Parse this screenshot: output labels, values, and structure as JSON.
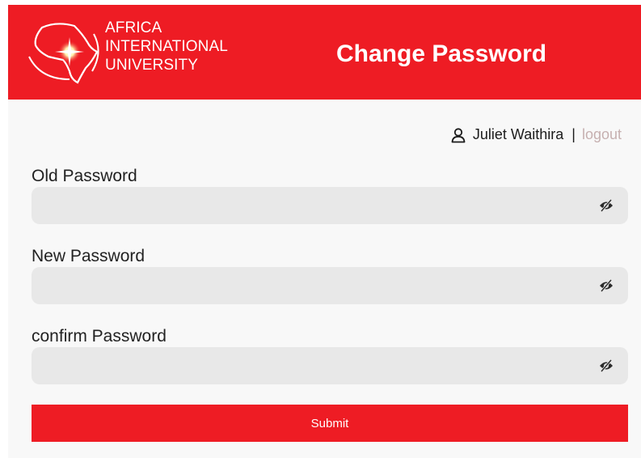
{
  "header": {
    "logo_lines": [
      "AFRICA",
      "INTERNATIONAL",
      "UNIVERSITY"
    ],
    "title": "Change Password",
    "logo_icon": "africa-star-logo",
    "brand_color": "#ee1c24"
  },
  "user": {
    "icon": "user-icon",
    "name": "Juliet Waithira",
    "separator": "|",
    "logout_label": "logout"
  },
  "form": {
    "fields": [
      {
        "label": "Old Password",
        "value": "",
        "toggle_icon": "eye-slash-icon"
      },
      {
        "label": "New Password",
        "value": "",
        "toggle_icon": "eye-slash-icon"
      },
      {
        "label": "confirm Password",
        "value": "",
        "toggle_icon": "eye-slash-icon"
      }
    ],
    "submit_label": "Submit"
  }
}
